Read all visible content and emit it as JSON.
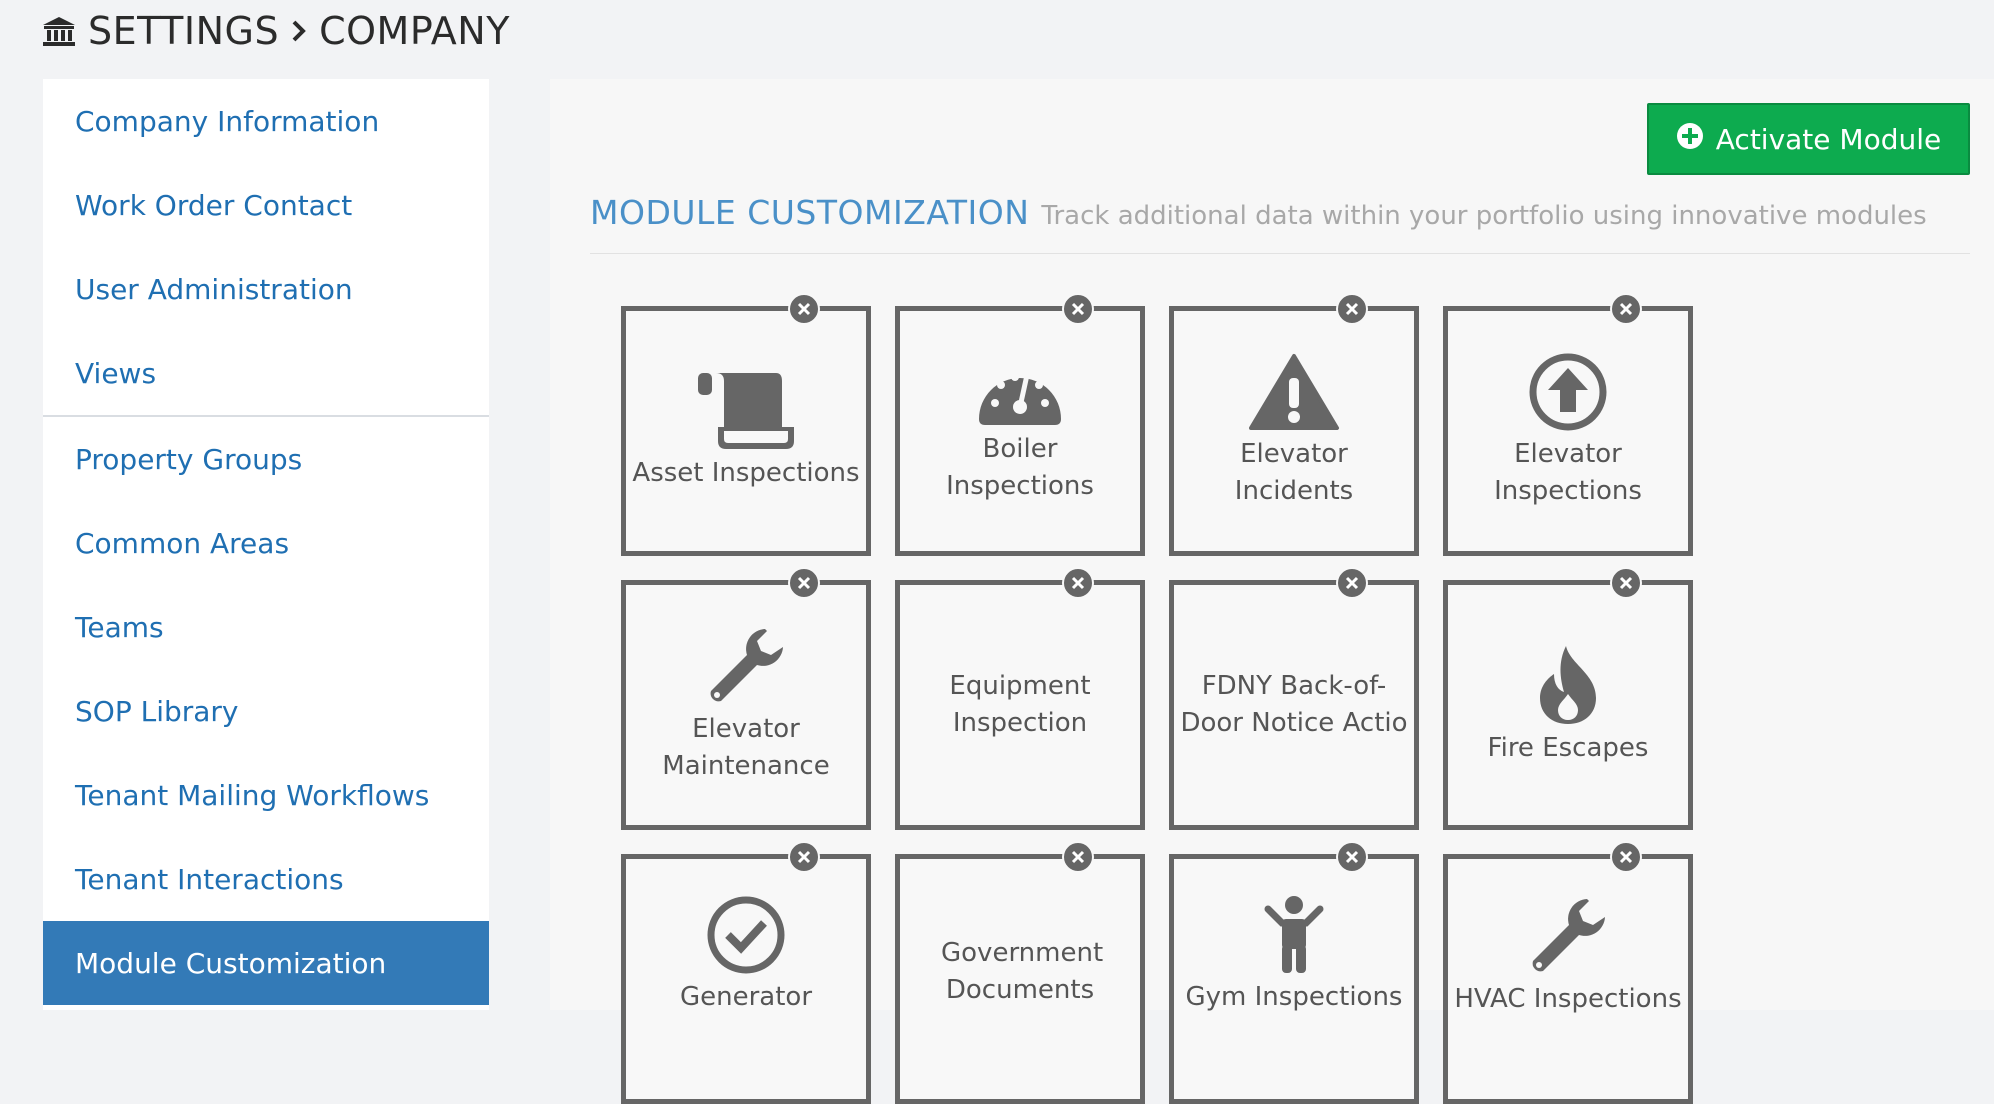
{
  "header": {
    "settings_label": "SETTINGS",
    "company_label": "COMPANY",
    "home_icon": "bank-icon",
    "separator_icon": "chevron-right-icon"
  },
  "sidebar": {
    "items": [
      {
        "label": "Company Information"
      },
      {
        "label": "Work Order Contact"
      },
      {
        "label": "User Administration"
      },
      {
        "label": "Views"
      },
      {
        "label": "Property Groups"
      },
      {
        "label": "Common Areas"
      },
      {
        "label": "Teams"
      },
      {
        "label": "SOP Library"
      },
      {
        "label": "Tenant Mailing Workflows"
      },
      {
        "label": "Tenant Interactions"
      },
      {
        "label": "Module Customization"
      }
    ],
    "active_index": 10
  },
  "main": {
    "activate_label": "Activate Module",
    "title": "MODULE CUSTOMIZATION",
    "subtitle": "Track additional data within your portfolio using innovative modules",
    "modules": [
      {
        "label": "Asset Inspections",
        "icon": "scroll-icon"
      },
      {
        "label": "Boiler Inspections",
        "icon": "gauge-icon"
      },
      {
        "label": "Elevator Incidents",
        "icon": "warning-icon"
      },
      {
        "label": "Elevator Inspections",
        "icon": "arrow-circle-up-icon"
      },
      {
        "label": "Elevator Maintenance",
        "icon": "wrench-icon"
      },
      {
        "label": "Equipment Inspection",
        "icon": ""
      },
      {
        "label": "FDNY Back-of-Door Notice Actio",
        "icon": ""
      },
      {
        "label": "Fire Escapes",
        "icon": "fire-icon"
      },
      {
        "label": "Generator",
        "icon": "check-circle-icon"
      },
      {
        "label": "Government Documents",
        "icon": ""
      },
      {
        "label": "Gym Inspections",
        "icon": "child-icon"
      },
      {
        "label": "HVAC Inspections",
        "icon": "wrench-icon"
      }
    ]
  },
  "colors": {
    "accent": "#337ab7",
    "link": "#1f6fb2",
    "success": "#0dab4f",
    "tile_border": "#666666"
  }
}
